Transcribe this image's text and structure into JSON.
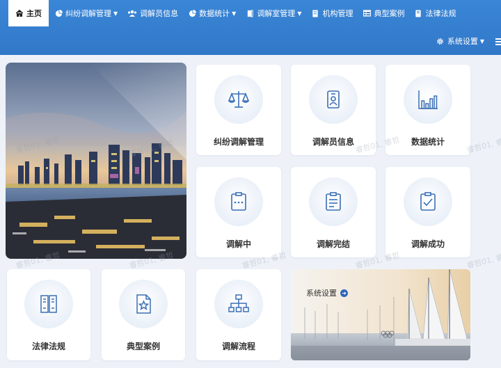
{
  "nav": {
    "home": "主页",
    "dispute": "纠纷调解管理",
    "mediator": "调解员信息",
    "stats": "数据统计",
    "room": "调解室管理",
    "org": "机构管理",
    "cases": "典型案例",
    "laws": "法律法规",
    "settings": "系统设置"
  },
  "tiles": {
    "dispute": "纠纷调解管理",
    "mediator": "调解员信息",
    "stats": "数据统计",
    "mediating": "调解中",
    "completed": "调解完结",
    "success": "调解成功",
    "laws": "法律法规",
    "cases": "典型案例",
    "process": "调解流程"
  },
  "settings_panel": {
    "label": "系统设置"
  },
  "watermark": "睿哲01, 睿哲",
  "colors": {
    "nav_bg": "#3278c9",
    "icon": "#3a6fb5",
    "accent": "#2f66b8"
  }
}
